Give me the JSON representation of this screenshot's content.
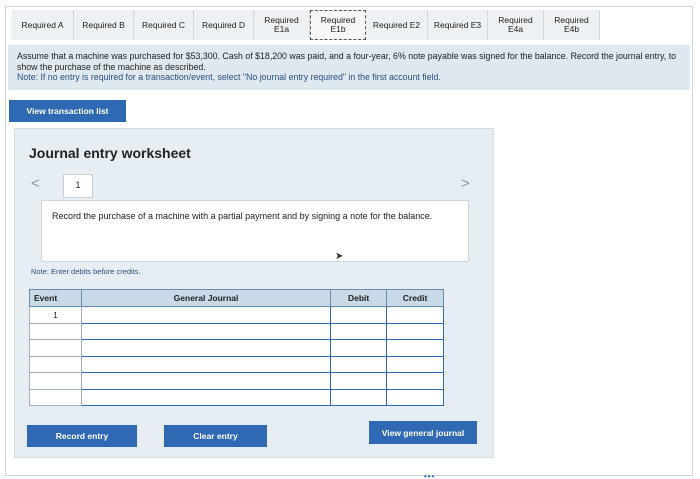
{
  "tabs": [
    {
      "line1": "Required A",
      "line2": ""
    },
    {
      "line1": "Required B",
      "line2": ""
    },
    {
      "line1": "Required C",
      "line2": ""
    },
    {
      "line1": "Required D",
      "line2": ""
    },
    {
      "line1": "Required",
      "line2": "E1a"
    },
    {
      "line1": "Required",
      "line2": "E1b"
    },
    {
      "line1": "Required E2",
      "line2": ""
    },
    {
      "line1": "Required E3",
      "line2": ""
    },
    {
      "line1": "Required",
      "line2": "E4a"
    },
    {
      "line1": "Required",
      "line2": "E4b"
    }
  ],
  "banner": {
    "text": "Assume that a machine was purchased for $53,300. Cash of $18,200 was paid, and a four-year, 6% note payable was signed for the balance. Record the journal entry, to show the purchase of the machine as described.",
    "note": "Note: If no entry is required for a transaction/event, select \"No journal entry required\" in the first account field."
  },
  "view_transaction_label": "View transaction list",
  "worksheet": {
    "title": "Journal entry worksheet",
    "prev_icon": "<",
    "next_icon": ">",
    "page": "1",
    "description": "Record the purchase of a machine with a partial payment and by signing a note for the balance.",
    "debit_note": "Note: Enter debits before credits.",
    "columns": {
      "event": "Event",
      "journal": "General Journal",
      "debit": "Debit",
      "credit": "Credit"
    },
    "rows": [
      {
        "event": "1",
        "journal": "",
        "debit": "",
        "credit": ""
      },
      {
        "event": "",
        "journal": "",
        "debit": "",
        "credit": ""
      },
      {
        "event": "",
        "journal": "",
        "debit": "",
        "credit": ""
      },
      {
        "event": "",
        "journal": "",
        "debit": "",
        "credit": ""
      },
      {
        "event": "",
        "journal": "",
        "debit": "",
        "credit": ""
      },
      {
        "event": "",
        "journal": "",
        "debit": "",
        "credit": ""
      }
    ]
  },
  "buttons": {
    "record": "Record entry",
    "clear": "Clear entry",
    "view_journal": "View general journal"
  }
}
